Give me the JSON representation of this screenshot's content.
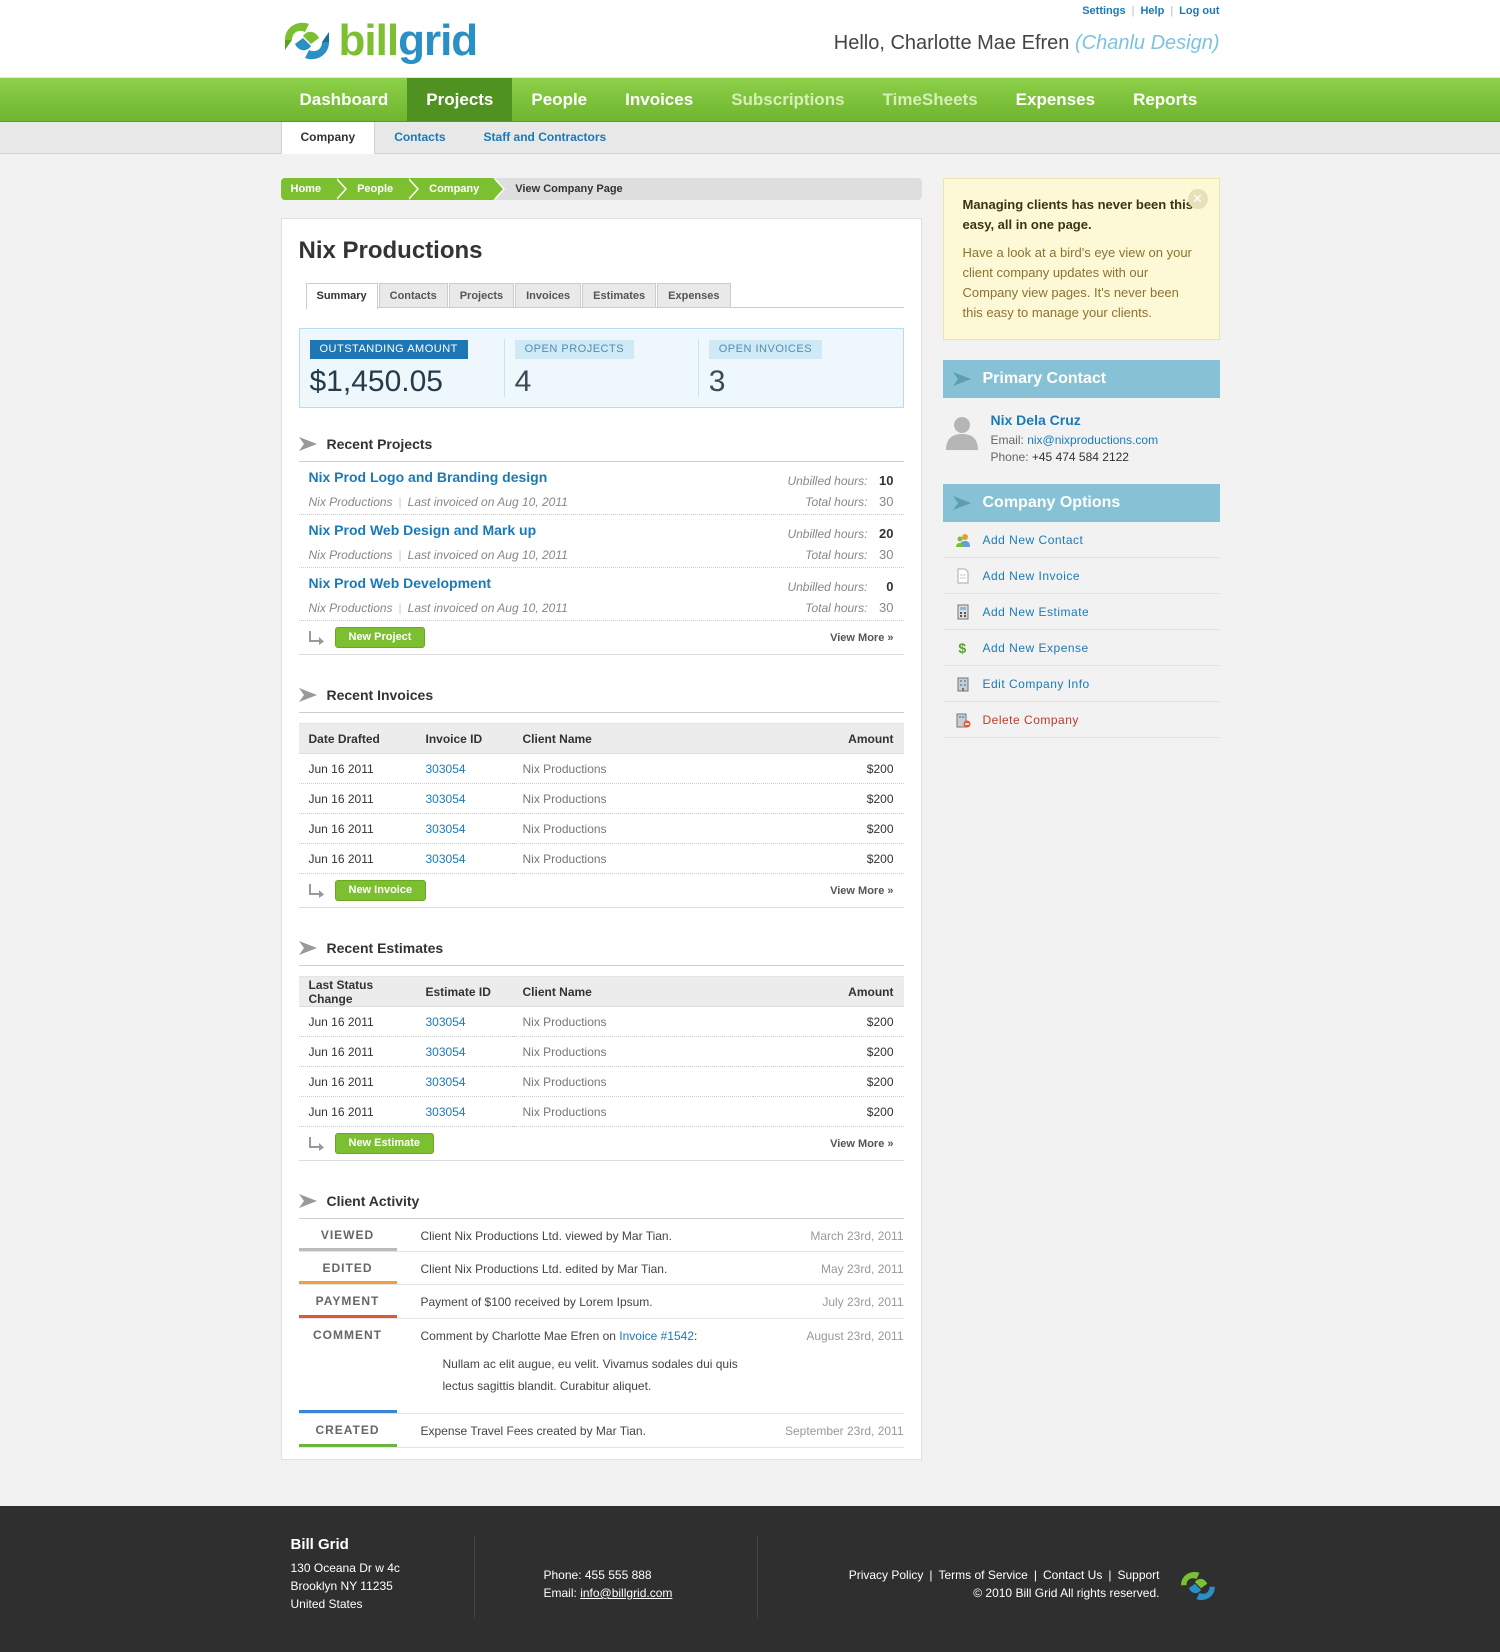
{
  "brand": {
    "logo_part1": "bill",
    "logo_part2": "grid"
  },
  "toplinks": {
    "settings": "Settings",
    "help": "Help",
    "logout": "Log out"
  },
  "greeting": {
    "hello": "Hello, Charlotte Mae Efren",
    "company": "(Chanlu Design)"
  },
  "mainnav": [
    "Dashboard",
    "Projects",
    "People",
    "Invoices",
    "Subscriptions",
    "TimeSheets",
    "Expenses",
    "Reports"
  ],
  "subnav": [
    "Company",
    "Contacts",
    "Staff and Contractors"
  ],
  "breadcrumb": {
    "items": [
      "Home",
      "People",
      "Company"
    ],
    "current": "View Company Page"
  },
  "company": {
    "name": "Nix Productions"
  },
  "tabs": [
    "Summary",
    "Contacts",
    "Projects",
    "Invoices",
    "Estimates",
    "Expenses"
  ],
  "stats": {
    "outstanding_label": "OUTSTANDING AMOUNT",
    "outstanding_value": "$1,450.05",
    "projects_label": "OPEN PROJECTS",
    "projects_value": "4",
    "invoices_label": "OPEN INVOICES",
    "invoices_value": "3"
  },
  "recent_projects": {
    "title": "Recent Projects",
    "unbilled_label": "Unbilled hours:",
    "total_label": "Total hours:",
    "items": [
      {
        "name": "Nix Prod Logo and Branding design",
        "client": "Nix Productions",
        "last": "Last invoiced on Aug 10, 2011",
        "unbilled": "10",
        "total": "30"
      },
      {
        "name": "Nix Prod Web Design and Mark up",
        "client": "Nix Productions",
        "last": "Last invoiced on Aug 10, 2011",
        "unbilled": "20",
        "total": "30"
      },
      {
        "name": "Nix Prod Web Development",
        "client": "Nix Productions",
        "last": "Last invoiced on Aug 10, 2011",
        "unbilled": "0",
        "total": "30"
      }
    ],
    "new_label": "New Project",
    "view_more": "View More »"
  },
  "recent_invoices": {
    "title": "Recent Invoices",
    "headers": [
      "Date Drafted",
      "Invoice ID",
      "Client Name",
      "Amount"
    ],
    "rows": [
      [
        "Jun 16 2011",
        "303054",
        "Nix Productions",
        "$200"
      ],
      [
        "Jun 16 2011",
        "303054",
        "Nix Productions",
        "$200"
      ],
      [
        "Jun 16 2011",
        "303054",
        "Nix Productions",
        "$200"
      ],
      [
        "Jun 16 2011",
        "303054",
        "Nix Productions",
        "$200"
      ]
    ],
    "new_label": "New Invoice",
    "view_more": "View More »"
  },
  "recent_estimates": {
    "title": "Recent Estimates",
    "headers": [
      "Last Status Change",
      "Estimate ID",
      "Client Name",
      "Amount"
    ],
    "rows": [
      [
        "Jun 16 2011",
        "303054",
        "Nix Productions",
        "$200"
      ],
      [
        "Jun 16 2011",
        "303054",
        "Nix Productions",
        "$200"
      ],
      [
        "Jun 16 2011",
        "303054",
        "Nix Productions",
        "$200"
      ],
      [
        "Jun 16 2011",
        "303054",
        "Nix Productions",
        "$200"
      ]
    ],
    "new_label": "New Estimate",
    "view_more": "View More »"
  },
  "activity": {
    "title": "Client Activity",
    "items": [
      {
        "tag": "VIEWED",
        "color": "#bbbbbb",
        "text": "Client Nix Productions Ltd. viewed by Mar Tian.",
        "date": "March 23rd, 2011"
      },
      {
        "tag": "EDITED",
        "color": "#f0a040",
        "text": "Client Nix Productions Ltd. edited by Mar Tian.",
        "date": "May 23rd, 2011"
      },
      {
        "tag": "PAYMENT",
        "color": "#e0583b",
        "text": "Payment of $100 received by Lorem Ipsum.",
        "date": "July 23rd, 2011"
      },
      {
        "tag": "COMMENT",
        "color": "#3c86d8",
        "text": "Comment by Charlotte Mae Efren on ",
        "link": "Invoice #1542",
        "suffix": ":",
        "quote1": "Nullam ac elit augue, eu velit. Vivamus sodales dui quis",
        "quote2": "lectus sagittis blandit. Curabitur aliquet.",
        "date": "August 23rd, 2011"
      },
      {
        "tag": "CREATED",
        "color": "#6db33f",
        "text": "Expense Travel Fees created by Mar Tian.",
        "date": "September 23rd, 2011"
      }
    ]
  },
  "tip": {
    "title": "Managing clients has never been this easy, all in one page.",
    "body": "Have a look at a bird's eye view on your client company updates with our Company view pages. It's never been this easy to manage your clients."
  },
  "primary_contact": {
    "title": "Primary Contact",
    "name": "Nix Dela Cruz",
    "email_label": "Email: ",
    "email": "nix@nixproductions.com",
    "phone_label": "Phone: ",
    "phone": "+45 474 584 2122"
  },
  "company_options": {
    "title": "Company Options",
    "items": [
      {
        "label": "Add New Contact",
        "icon": "contact-icon"
      },
      {
        "label": "Add New Invoice",
        "icon": "document-icon"
      },
      {
        "label": "Add New Estimate",
        "icon": "calculator-icon"
      },
      {
        "label": "Add New Expense",
        "icon": "dollar-icon"
      },
      {
        "label": "Edit Company Info",
        "icon": "building-icon"
      },
      {
        "label": "Delete Company",
        "icon": "delete-building-icon"
      }
    ]
  },
  "footer": {
    "name": "Bill Grid",
    "addr1": "130 Oceana Dr w 4c",
    "addr2": "Brooklyn NY 11235",
    "addr3": "United States",
    "phone": "Phone: 455 555 888",
    "email_label": "Email: ",
    "email": "info@billgrid.com",
    "links": [
      "Privacy Policy",
      "Terms of Service",
      "Contact Us",
      "Support"
    ],
    "copyright": "© 2010 Bill Grid All rights reserved."
  },
  "colors": {
    "green": "#7cc031",
    "blue_link": "#1a7ab8",
    "side_head": "#86c1d5"
  }
}
